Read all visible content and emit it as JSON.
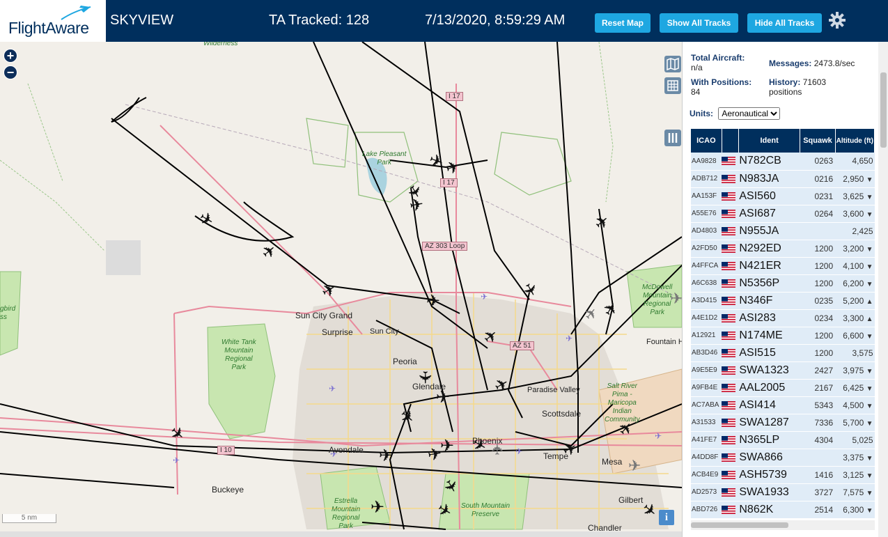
{
  "header": {
    "logo_text": "FlightAware",
    "title": "SKYVIEW",
    "tracked": "TA Tracked: 128",
    "datetime": "7/13/2020, 8:59:29 AM",
    "reset_label": "Reset Map",
    "show_label": "Show All Tracks",
    "hide_label": "Hide All Tracks"
  },
  "map": {
    "zoom_in": "+",
    "zoom_out": "−",
    "scale": "5 nm",
    "info": "i",
    "cities": [
      "Sun City Grand",
      "Surprise",
      "Sun City",
      "Peoria",
      "Glendale",
      "Paradise Valley",
      "Scottsdale",
      "Phoenix",
      "Tempe",
      "Mesa",
      "Avondale",
      "Buckeye",
      "Gilbert",
      "Chandler",
      "Fountain Hi"
    ],
    "parks": [
      "White Tank\nMountain\nRegional\nPark",
      "Estrella\nMountain\nRegional\nPark",
      "South Mountain\nPreserve",
      "Lake Pleasant\nPark",
      "Salt River\nPima -\nMaricopa\nIndian\nCommunity",
      "McDowell\nMountain\nRegional\nPark",
      "Wilderness",
      "gbird\nss"
    ],
    "highways": [
      "I 17",
      "I 17",
      "AZ 303 Loop",
      "AZ 51",
      "I 10"
    ]
  },
  "panel": {
    "total_label": "Total Aircraft:",
    "total_value": "n/a",
    "messages_label": "Messages:",
    "messages_value": "2473.8/sec",
    "positions_label": "With Positions:",
    "positions_value": "84",
    "history_label": "History:",
    "history_value": "71603 positions",
    "units_label": "Units:",
    "units_value": "Aeronautical",
    "columns": [
      "ICAO",
      "",
      "Ident",
      "Squawk",
      "Altitude (ft)"
    ],
    "rows": [
      {
        "icao": "AA9828",
        "ident": "N782CB",
        "squawk": "0263",
        "alt": "4,650",
        "trend": ""
      },
      {
        "icao": "ADB712",
        "ident": "N983JA",
        "squawk": "0216",
        "alt": "2,950",
        "trend": "▼"
      },
      {
        "icao": "AA153F",
        "ident": "ASI560",
        "squawk": "0231",
        "alt": "3,625",
        "trend": "▼"
      },
      {
        "icao": "A55E76",
        "ident": "ASI687",
        "squawk": "0264",
        "alt": "3,600",
        "trend": "▼"
      },
      {
        "icao": "AD4803",
        "ident": "N955JA",
        "squawk": "",
        "alt": "2,425",
        "trend": ""
      },
      {
        "icao": "A2FD50",
        "ident": "N292ED",
        "squawk": "1200",
        "alt": "3,200",
        "trend": "▼"
      },
      {
        "icao": "A4FFCA",
        "ident": "N421ER",
        "squawk": "1200",
        "alt": "4,100",
        "trend": "▼"
      },
      {
        "icao": "A6C638",
        "ident": "N5356P",
        "squawk": "1200",
        "alt": "6,200",
        "trend": "▼"
      },
      {
        "icao": "A3D415",
        "ident": "N346F",
        "squawk": "0235",
        "alt": "5,200",
        "trend": "▲"
      },
      {
        "icao": "A4E1D2",
        "ident": "ASI283",
        "squawk": "0234",
        "alt": "3,300",
        "trend": "▲"
      },
      {
        "icao": "A12921",
        "ident": "N174ME",
        "squawk": "1200",
        "alt": "6,600",
        "trend": "▼"
      },
      {
        "icao": "AB3D46",
        "ident": "ASI515",
        "squawk": "1200",
        "alt": "3,575",
        "trend": ""
      },
      {
        "icao": "A9E5E9",
        "ident": "SWA1323",
        "squawk": "2427",
        "alt": "3,975",
        "trend": "▼"
      },
      {
        "icao": "A9FB4E",
        "ident": "AAL2005",
        "squawk": "2167",
        "alt": "6,425",
        "trend": "▼"
      },
      {
        "icao": "AC7ABA",
        "ident": "ASI414",
        "squawk": "5343",
        "alt": "4,500",
        "trend": "▼"
      },
      {
        "icao": "A31533",
        "ident": "SWA1287",
        "squawk": "7336",
        "alt": "5,700",
        "trend": "▼"
      },
      {
        "icao": "A41FE7",
        "ident": "N365LP",
        "squawk": "4304",
        "alt": "5,025",
        "trend": ""
      },
      {
        "icao": "A4DD8F",
        "ident": "SWA866",
        "squawk": "",
        "alt": "3,375",
        "trend": "▼"
      },
      {
        "icao": "ACB4E9",
        "ident": "ASH5739",
        "squawk": "1416",
        "alt": "3,125",
        "trend": "▼"
      },
      {
        "icao": "AD2573",
        "ident": "SWA1933",
        "squawk": "3727",
        "alt": "7,575",
        "trend": "▼"
      },
      {
        "icao": "ABD726",
        "ident": "N862K",
        "squawk": "2514",
        "alt": "6,300",
        "trend": "▼"
      }
    ]
  },
  "colors": {
    "header_bg": "#002f5d",
    "button_bg": "#1ea7e1",
    "row_bg": "#e0ecf7",
    "park_green": "#c8e6b0",
    "road_pink": "#e8899c",
    "road_yellow": "#f5d98a"
  }
}
